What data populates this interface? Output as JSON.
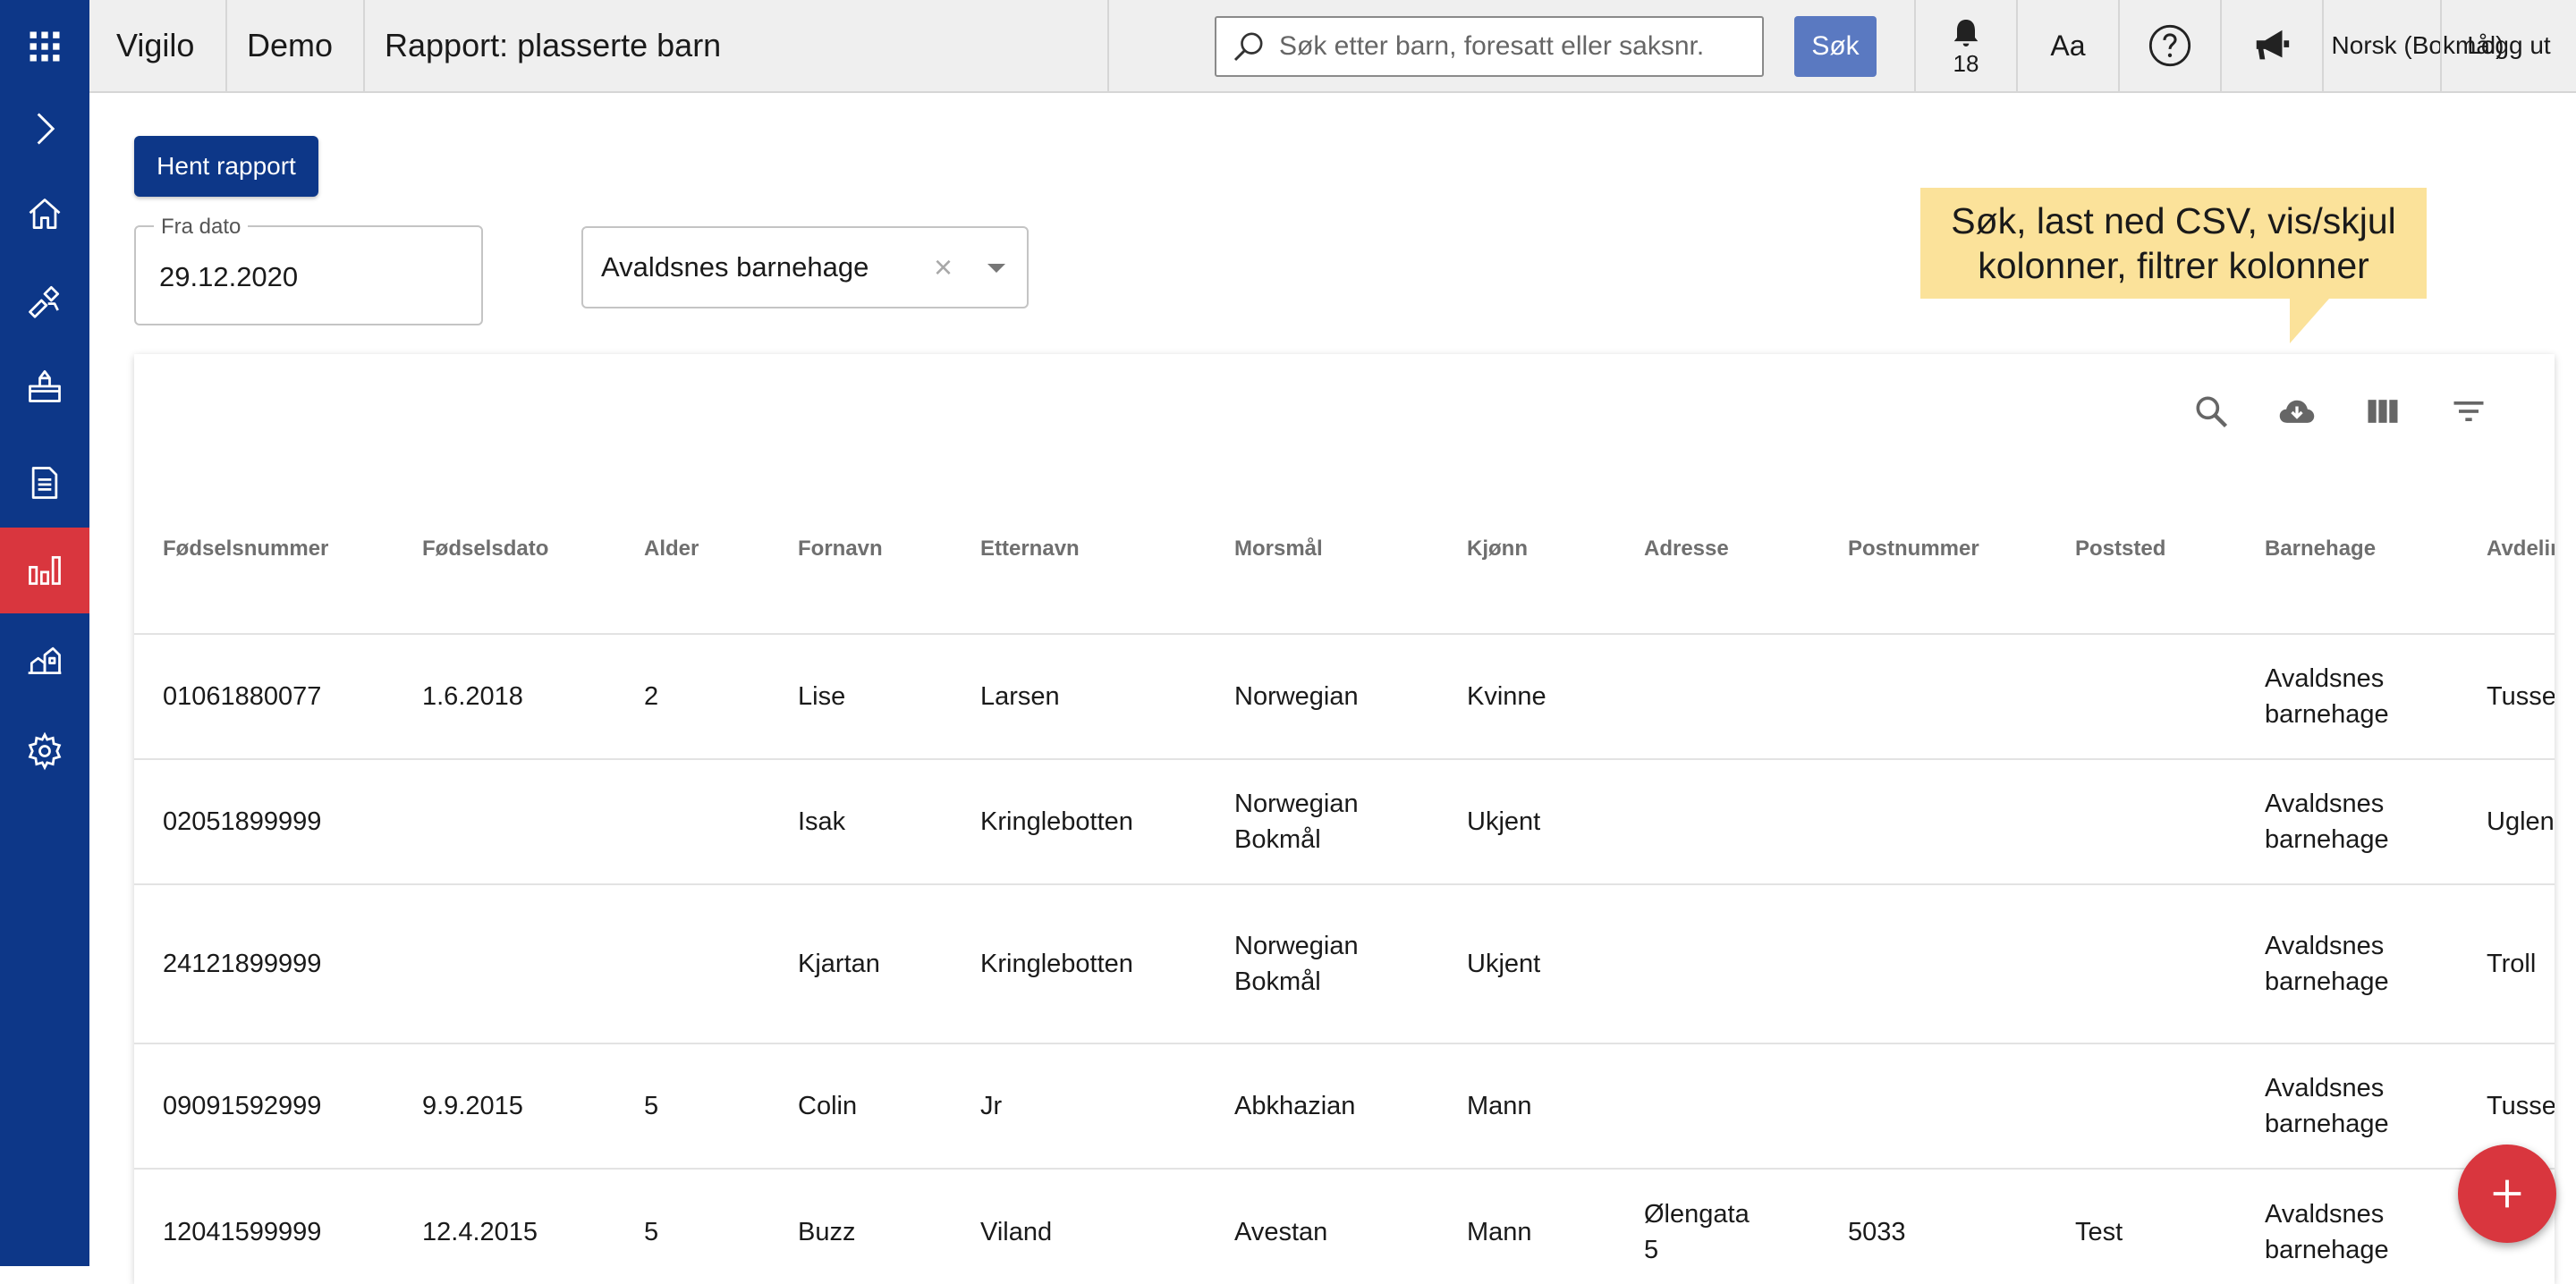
{
  "app": {
    "name": "Vigilo",
    "tenant": "Demo",
    "page_title": "Rapport: plasserte barn"
  },
  "topbar": {
    "search_placeholder": "Søk etter barn, foresatt eller saksnr.",
    "search_button": "Søk",
    "notifications_count": "18",
    "font_size_label": "Aa",
    "language": "Norsk (Bokmål)",
    "logout": "Logg ut"
  },
  "sidebar": {
    "items": [
      {
        "name": "apps-icon"
      },
      {
        "name": "expand-chevron-icon"
      },
      {
        "name": "home-icon"
      },
      {
        "name": "toys-icon"
      },
      {
        "name": "kindergarten-icon"
      },
      {
        "name": "document-icon"
      },
      {
        "name": "reports-icon",
        "active": true
      },
      {
        "name": "buildings-icon"
      },
      {
        "name": "settings-icon"
      }
    ]
  },
  "controls": {
    "fetch_report_button": "Hent rapport",
    "from_date_label": "Fra dato",
    "from_date_value": "29.12.2020",
    "kindergarten_select": "Avaldsnes barnehage",
    "clear_symbol": "×"
  },
  "tooltip": {
    "line1": "Søk, last ned CSV, vis/skjul",
    "line2": "kolonner, filtrer kolonner"
  },
  "table": {
    "columns": [
      "Fødselsnummer",
      "Fødselsdato",
      "Alder",
      "Fornavn",
      "Etternavn",
      "Morsmål",
      "Kjønn",
      "Adresse",
      "Postnummer",
      "Poststed",
      "Barnehage",
      "Avdeling"
    ],
    "rows": [
      {
        "fnr": "01061880077",
        "dob": "1.6.2018",
        "age": "2",
        "first": "Lise",
        "last": "Larsen",
        "lang1": "Norwegian",
        "lang2": "",
        "gender": "Kvinne",
        "addr1": "",
        "addr2": "",
        "zip": "",
        "city": "",
        "kg1": "Avaldsnes",
        "kg2": "barnehage",
        "dept": "Tusse"
      },
      {
        "fnr": "02051899999",
        "dob": "",
        "age": "",
        "first": "Isak",
        "last": "Kringlebotten",
        "lang1": "Norwegian",
        "lang2": "Bokmål",
        "gender": "Ukjent",
        "addr1": "",
        "addr2": "",
        "zip": "",
        "city": "",
        "kg1": "Avaldsnes",
        "kg2": "barnehage",
        "dept": "Uglen"
      },
      {
        "fnr": "24121899999",
        "dob": "",
        "age": "",
        "first": "Kjartan",
        "last": "Kringlebotten",
        "lang1": "Norwegian",
        "lang2": "Bokmål",
        "gender": "Ukjent",
        "addr1": "",
        "addr2": "",
        "zip": "",
        "city": "",
        "kg1": "Avaldsnes",
        "kg2": "barnehage",
        "dept": "Troll"
      },
      {
        "fnr": "09091592999",
        "dob": "9.9.2015",
        "age": "5",
        "first": "Colin",
        "last": "Jr",
        "lang1": "Abkhazian",
        "lang2": "",
        "gender": "Mann",
        "addr1": "",
        "addr2": "",
        "zip": "",
        "city": "",
        "kg1": "Avaldsnes",
        "kg2": "barnehage",
        "dept": "Tusse"
      },
      {
        "fnr": "12041599999",
        "dob": "12.4.2015",
        "age": "5",
        "first": "Buzz",
        "last": "Viland",
        "lang1": "Avestan",
        "lang2": "",
        "gender": "Mann",
        "addr1": "Ølengata",
        "addr2": "5",
        "zip": "5033",
        "city": "Test",
        "kg1": "Avaldsnes",
        "kg2": "barnehage",
        "dept": ""
      }
    ]
  },
  "colors": {
    "sidebar_bg": "#0d3788",
    "active_red": "#d9363e",
    "search_button": "#5a79c1",
    "tooltip_bg": "#fbe29a"
  }
}
